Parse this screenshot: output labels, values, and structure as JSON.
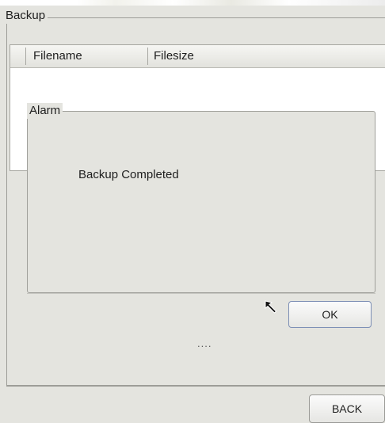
{
  "backup": {
    "title": "Backup",
    "columns": [
      "Filename",
      "Filesize"
    ]
  },
  "alarm": {
    "title": "Alarm",
    "message": "Backup Completed",
    "ok_label": "OK"
  },
  "progress_text": "....",
  "footer": {
    "back_label": "BACK"
  }
}
